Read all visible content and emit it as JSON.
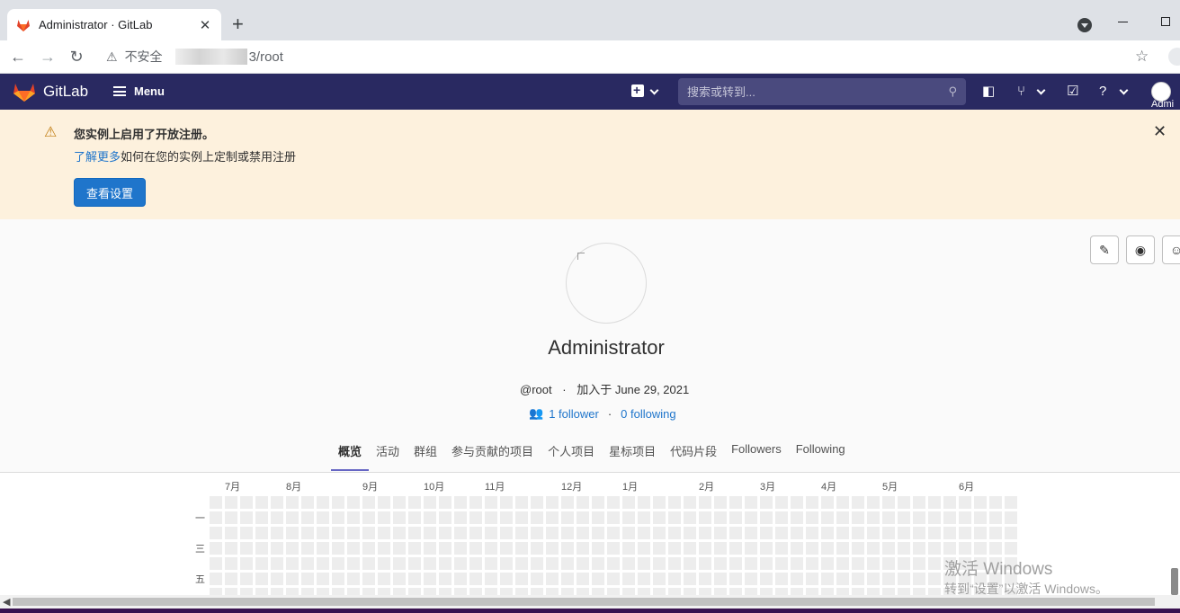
{
  "browser": {
    "tab_title": "Administrator · GitLab",
    "insecure_label": "不安全",
    "url_path": "3/root"
  },
  "header": {
    "brand": "GitLab",
    "menu_label": "Menu",
    "search_placeholder": "搜索或转到...",
    "user_short": "Admi"
  },
  "banner": {
    "title": "您实例上启用了开放注册。",
    "link_text": "了解更多",
    "text": "如何在您的实例上定制或禁用注册",
    "button_label": "查看设置"
  },
  "profile": {
    "name": "Administrator",
    "username": "@root",
    "dot": "·",
    "joined": "加入于 June 29, 2021",
    "followers": "1 follower",
    "following": "0 following"
  },
  "tabs": [
    "概览",
    "活动",
    "群组",
    "参与贡献的项目",
    "个人项目",
    "星标项目",
    "代码片段",
    "Followers",
    "Following"
  ],
  "calendar": {
    "months": [
      "7月",
      "8月",
      "9月",
      "10月",
      "11月",
      "12月",
      "1月",
      "2月",
      "3月",
      "4月",
      "5月",
      "6月"
    ],
    "day_labels": [
      "一",
      "三",
      "五"
    ]
  },
  "watermark": {
    "line1": "激活 Windows",
    "line2": "转到“设置”以激活 Windows。"
  }
}
